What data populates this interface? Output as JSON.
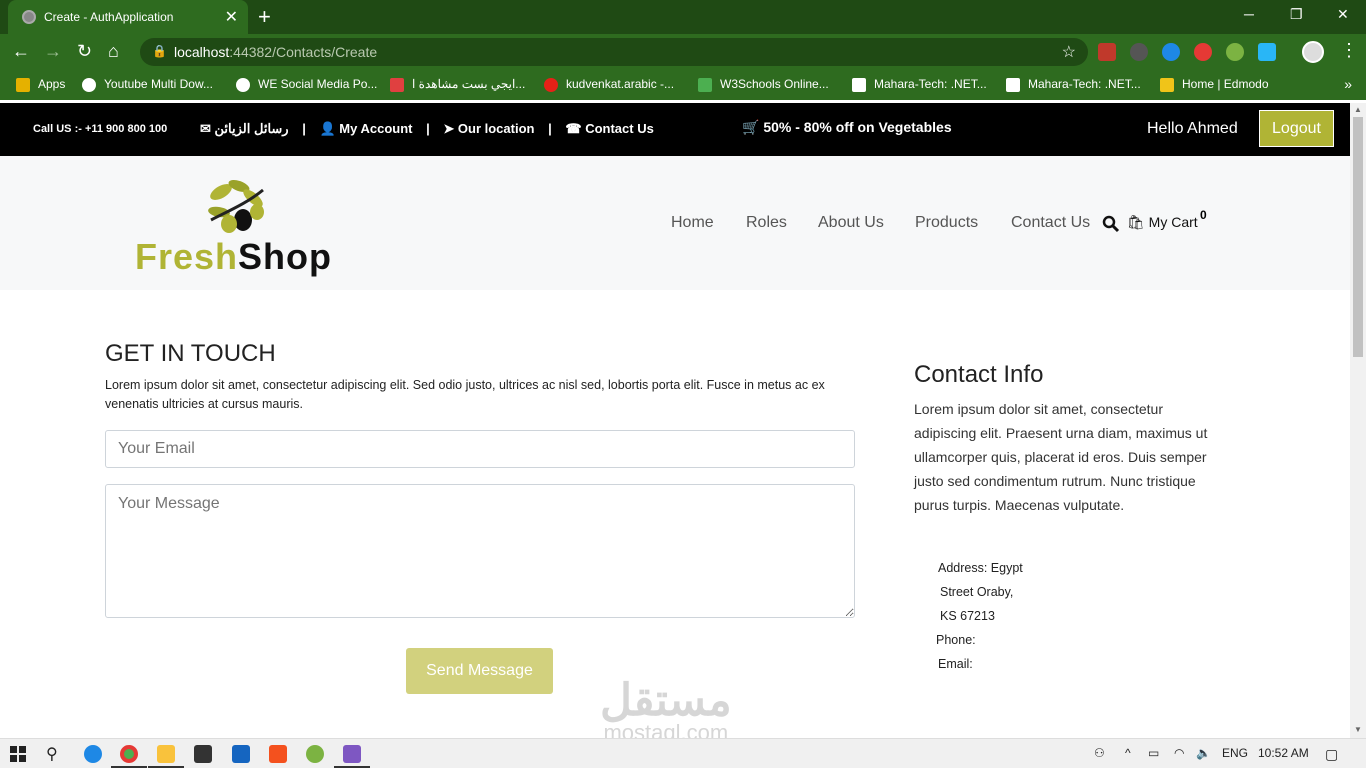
{
  "browser": {
    "tab_title": "Create - AuthApplication",
    "url_host": "localhost",
    "url_rest": ":44382/Contacts/Create",
    "bookmarks": [
      {
        "label": "Apps",
        "color": "#e5b100"
      },
      {
        "label": "Youtube Multi Dow...",
        "color": "#ffffff"
      },
      {
        "label": "WE Social Media Po...",
        "color": "#ffffff"
      },
      {
        "label": "ايجي بست مشاهدة ا...",
        "color": "#e04040"
      },
      {
        "label": "kudvenkat.arabic -...",
        "color": "#e62117"
      },
      {
        "label": "W3Schools Online...",
        "color": "#4caf50"
      },
      {
        "label": "Mahara-Tech: .NET...",
        "color": "#ffffff"
      },
      {
        "label": "Mahara-Tech: .NET...",
        "color": "#ffffff"
      },
      {
        "label": "Home | Edmodo",
        "color": "#f0c419"
      }
    ],
    "more": "»"
  },
  "topbar": {
    "call": "Call US :- +11 900 800 100",
    "messages": "رسائل الزيائن",
    "my_account": "My Account",
    "our_location": "Our location",
    "contact_us": "Contact Us",
    "separator": "|",
    "offer": "50% - 80% off on Vegetables",
    "hello": "Hello Ahmed",
    "logout": "Logout"
  },
  "header": {
    "brand_fresh": "Fresh",
    "brand_shop": "Shop",
    "nav": [
      "Home",
      "Roles",
      "About Us",
      "Products",
      "Contact Us"
    ],
    "cart_label": "My Cart",
    "cart_count": "0"
  },
  "form": {
    "title": "GET IN TOUCH",
    "text": "Lorem ipsum dolor sit amet, consectetur adipiscing elit. Sed odio justo, ultrices ac nisl sed, lobortis porta elit. Fusce in metus ac ex venenatis ultricies at cursus mauris.",
    "email_placeholder": "Your Email",
    "message_placeholder": "Your Message",
    "send": "Send Message"
  },
  "contact_info": {
    "title": "Contact Info",
    "text": "Lorem ipsum dolor sit amet, consectetur adipiscing elit. Praesent urna diam, maximus ut ullamcorper quis, placerat id eros. Duis semper justo sed condimentum rutrum. Nunc tristique purus turpis. Maecenas vulputate.",
    "address": "Address: Egypt",
    "street": "Street Oraby,",
    "zip": "KS 67213",
    "phone": "Phone:",
    "email": "Email:"
  },
  "watermark": {
    "ar": "مستقل",
    "en": "mostaql.com"
  },
  "taskbar": {
    "lang": "ENG",
    "time": "10:52 AM"
  }
}
